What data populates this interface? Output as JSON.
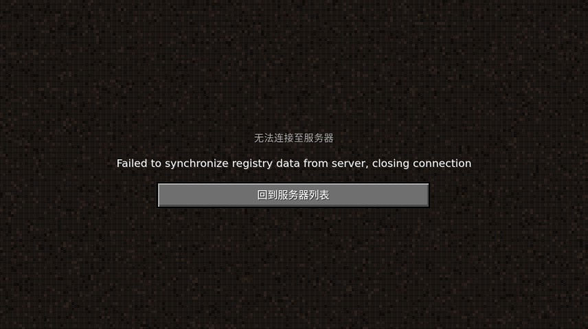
{
  "screen": {
    "title": "无法连接至服务器",
    "reason": "Failed to synchronize registry data from server, closing connection",
    "back_button_label": "回到服务器列表"
  },
  "colors": {
    "background": "#1b1512",
    "title_text": "#a8a8a8",
    "reason_text": "#f2f2f2",
    "button_face": "#6f6f6f",
    "button_border": "#000000",
    "button_text": "#ffffff"
  }
}
